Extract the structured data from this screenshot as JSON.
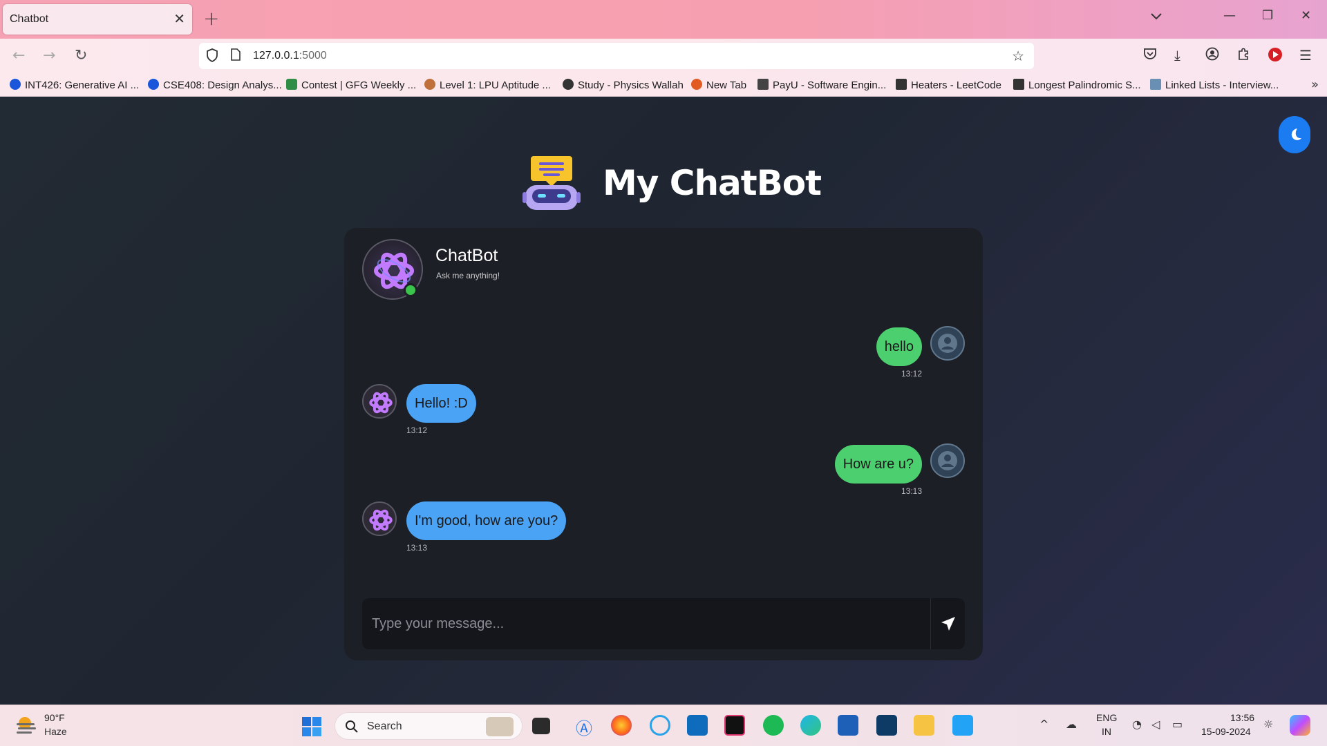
{
  "browser": {
    "tab_title": "Chatbot",
    "url_host": "127.0.0.1",
    "url_port": ":5000",
    "bookmarks": [
      {
        "label": "INT426: Generative AI ...",
        "color": "#1a56db"
      },
      {
        "label": "CSE408: Design Analys...",
        "color": "#1a56db"
      },
      {
        "label": "Contest | GFG Weekly ...",
        "color": "#2f8d46"
      },
      {
        "label": "Level 1: LPU Aptitude ...",
        "color": "#c0703a"
      },
      {
        "label": "Study - Physics Wallah",
        "color": "#333333"
      },
      {
        "label": "New Tab",
        "color": "#e25b23"
      },
      {
        "label": "PayU - Software Engin...",
        "color": "#444444"
      },
      {
        "label": "Heaters - LeetCode",
        "color": "#333333"
      },
      {
        "label": "Longest Palindromic S...",
        "color": "#333333"
      },
      {
        "label": "Linked Lists - Interview...",
        "color": "#6a8fb5"
      }
    ]
  },
  "app": {
    "title": "My ChatBot",
    "bot_name": "ChatBot",
    "bot_subtitle": "Ask me anything!",
    "input_placeholder": "Type your message...",
    "accent": "#1b7cf2",
    "user_bubble_color": "#4ccf6e",
    "bot_bubble_color": "#4aa3f5",
    "messages": [
      {
        "sender": "user",
        "text": "hello",
        "time": "13:12"
      },
      {
        "sender": "bot",
        "text": "Hello! :D",
        "time": "13:12"
      },
      {
        "sender": "user",
        "text": "How are u?",
        "time": "13:13"
      },
      {
        "sender": "bot",
        "text": "I'm good, how are you?",
        "time": "13:13"
      }
    ]
  },
  "taskbar": {
    "weather_temp": "90°F",
    "weather_desc": "Haze",
    "search_label": "Search",
    "lang_line1": "ENG",
    "lang_line2": "IN",
    "time": "13:56",
    "date": "15-09-2024"
  }
}
